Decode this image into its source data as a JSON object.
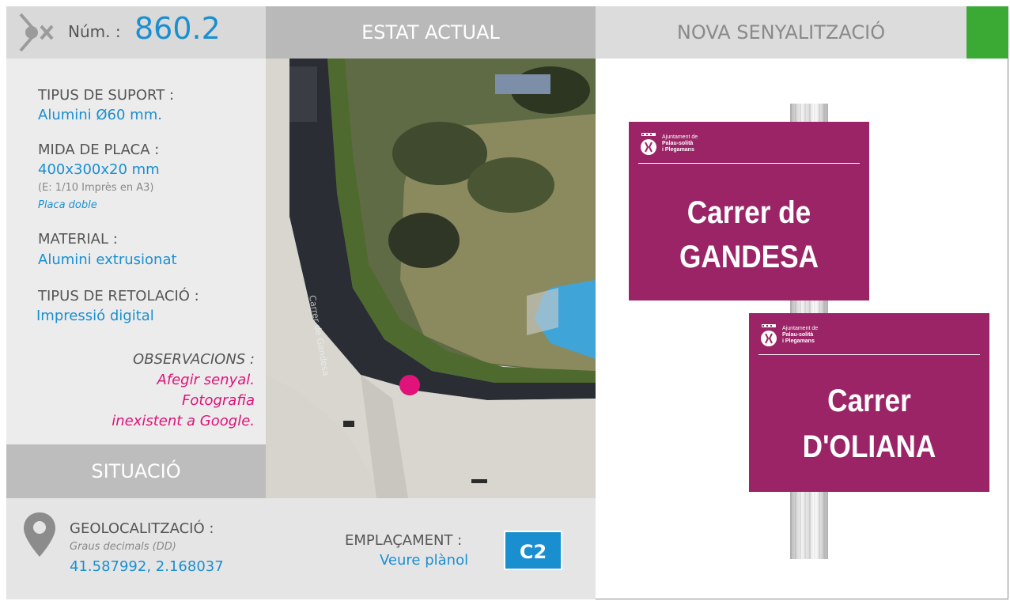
{
  "header": {
    "num_label": "Núm. :",
    "num_value": "860.2",
    "estat_actual": "ESTAT ACTUAL",
    "nova_senyalitzacio": "NOVA SENYALITZACIÓ",
    "status_color": "#3aaa35"
  },
  "specs": {
    "tipus_suport_label": "TIPUS DE SUPORT :",
    "tipus_suport_value": "Alumini Ø60 mm.",
    "mida_placa_label": "MIDA DE PLACA :",
    "mida_placa_value": "400x300x20 mm",
    "mida_placa_note": "(E: 1/10 Imprès en A3)",
    "mida_placa_type": "Placa doble",
    "material_label": "MATERIAL :",
    "material_value": "Alumini extrusionat",
    "retolacio_label": "TIPUS DE RETOLACIÓ :",
    "retolacio_value": "Impressió digital",
    "observacions_label": "OBSERVACIONS :",
    "observacions_lines": [
      "Afegir senyal.",
      "Fotografia",
      "inexistent a Google."
    ]
  },
  "situacio": {
    "label": "SITUACIÓ",
    "geo_label": "GEOLOCALITZACIÓ :",
    "geo_format": "Graus decimals (DD)",
    "geo_value": "41.587992, 2.168037",
    "emplacament_label": "EMPLAÇAMENT :",
    "emplacament_link": "Veure plànol",
    "emplacament_code": "C2"
  },
  "signs": [
    {
      "org_lines": [
        "Ajuntament de",
        "Palau-solità",
        "i Plegamans"
      ],
      "name_lines": [
        "Carrer de",
        "GANDESA"
      ]
    },
    {
      "org_lines": [
        "Ajuntament de",
        "Palau-solità",
        "i Plegamans"
      ],
      "name_lines": [
        "Carrer",
        "D'OLIANA"
      ]
    }
  ],
  "colors": {
    "accent_blue": "#1a8fd0",
    "observation_pink": "#e0137a",
    "sign_purple": "#9b2466"
  }
}
